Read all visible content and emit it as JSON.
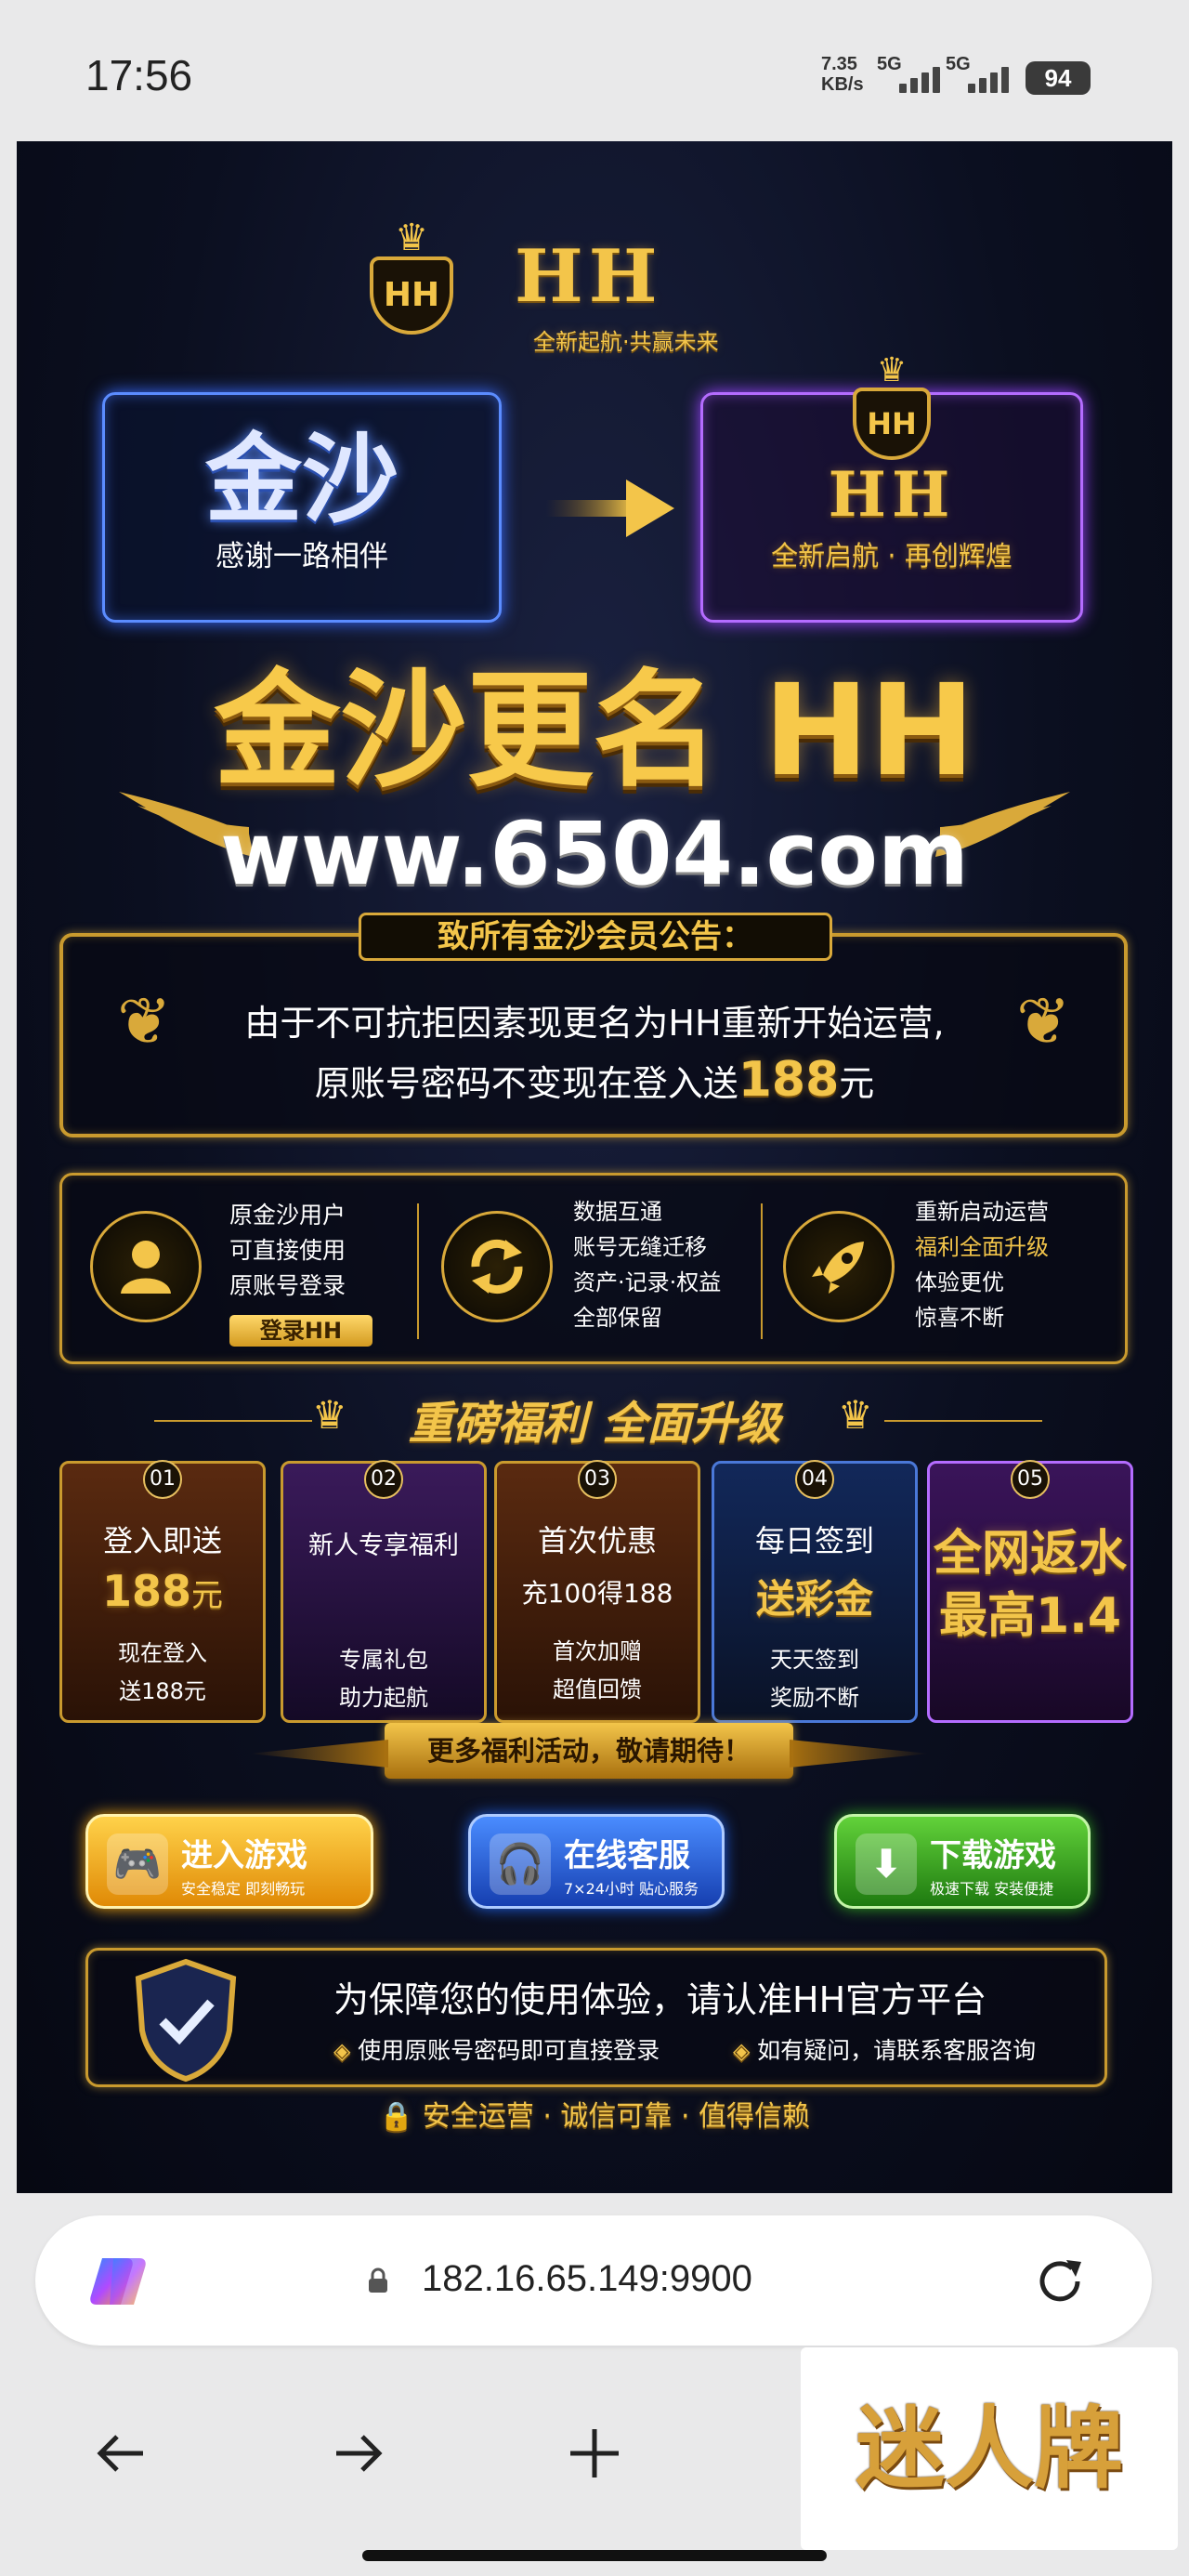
{
  "status": {
    "time": "17:56",
    "net_speed_value": "7.35",
    "net_speed_unit": "KB/s",
    "sim1": "5G",
    "sim2": "5G",
    "battery": "94"
  },
  "brand": {
    "logo_text": "HH",
    "name": "HH",
    "tagline": "全新起航·共赢未来"
  },
  "transition": {
    "old_name": "金沙",
    "old_sub": "感谢一路相伴",
    "new_badge": "HH",
    "new_name": "HH",
    "new_sub": "全新启航 · 再创辉煌"
  },
  "headline": {
    "title": "金沙更名 HH",
    "url": "www.6504.com"
  },
  "notice": {
    "title": "致所有金沙会员公告：",
    "line1": "由于不可抗拒因素现更名为HH重新开始运营,",
    "line2_prefix": "原账号密码不变现在登入送",
    "line2_amount": "188",
    "line2_suffix": "元"
  },
  "features": [
    {
      "icon": "user-icon",
      "lines": [
        "原金沙用户",
        "可直接使用",
        "原账号登录"
      ],
      "button": "登录HH"
    },
    {
      "icon": "sync-icon",
      "lines": [
        "数据互通",
        "账号无缝迁移",
        "资产·记录·权益",
        "全部保留"
      ]
    },
    {
      "icon": "rocket-icon",
      "lines": [
        "重新启动运营",
        "福利全面升级",
        "体验更优",
        "惊喜不断"
      ],
      "highlight_index": 1
    }
  ],
  "benefits": {
    "title": "重磅福利 全面升级",
    "cards": [
      {
        "num": "01",
        "title": "登入即送",
        "big": "188",
        "big_unit": "元",
        "desc": [
          "现在登入",
          "送188元"
        ]
      },
      {
        "num": "02",
        "title": "新人专享福利",
        "big": "",
        "big_unit": "",
        "desc": [
          "专属礼包",
          "助力起航"
        ]
      },
      {
        "num": "03",
        "title": "首次优惠",
        "big": "充100得188",
        "big_unit": "",
        "desc": [
          "首次加赠",
          "超值回馈"
        ]
      },
      {
        "num": "04",
        "title": "每日签到",
        "big": "送彩金",
        "big_unit": "",
        "desc": [
          "天天签到",
          "奖励不断"
        ]
      },
      {
        "num": "05",
        "title": "",
        "big": "全网返水",
        "big2": "最高1.4",
        "desc": []
      }
    ],
    "ribbon": "更多福利活动，敬请期待！"
  },
  "actions": [
    {
      "label": "进入游戏",
      "sub": "安全稳定 即刻畅玩",
      "icon": "gamepad-icon",
      "color": "#f0a40e"
    },
    {
      "label": "在线客服",
      "sub": "7×24小时 贴心服务",
      "icon": "headset-icon",
      "color": "#1f5fe0"
    },
    {
      "label": "下载游戏",
      "sub": "极速下载 安装便捷",
      "icon": "download-icon",
      "color": "#2f9d1e"
    }
  ],
  "trust": {
    "title": "为保障您的使用体验，请认准HH官方平台",
    "tip1": "使用原账号密码即可直接登录",
    "tip2": "如有疑问，请联系客服咨询",
    "footer": "安全运营 · 诚信可靠 · 值得信赖"
  },
  "browser": {
    "url": "182.16.65.149:9900"
  },
  "watermark": "迷人牌"
}
